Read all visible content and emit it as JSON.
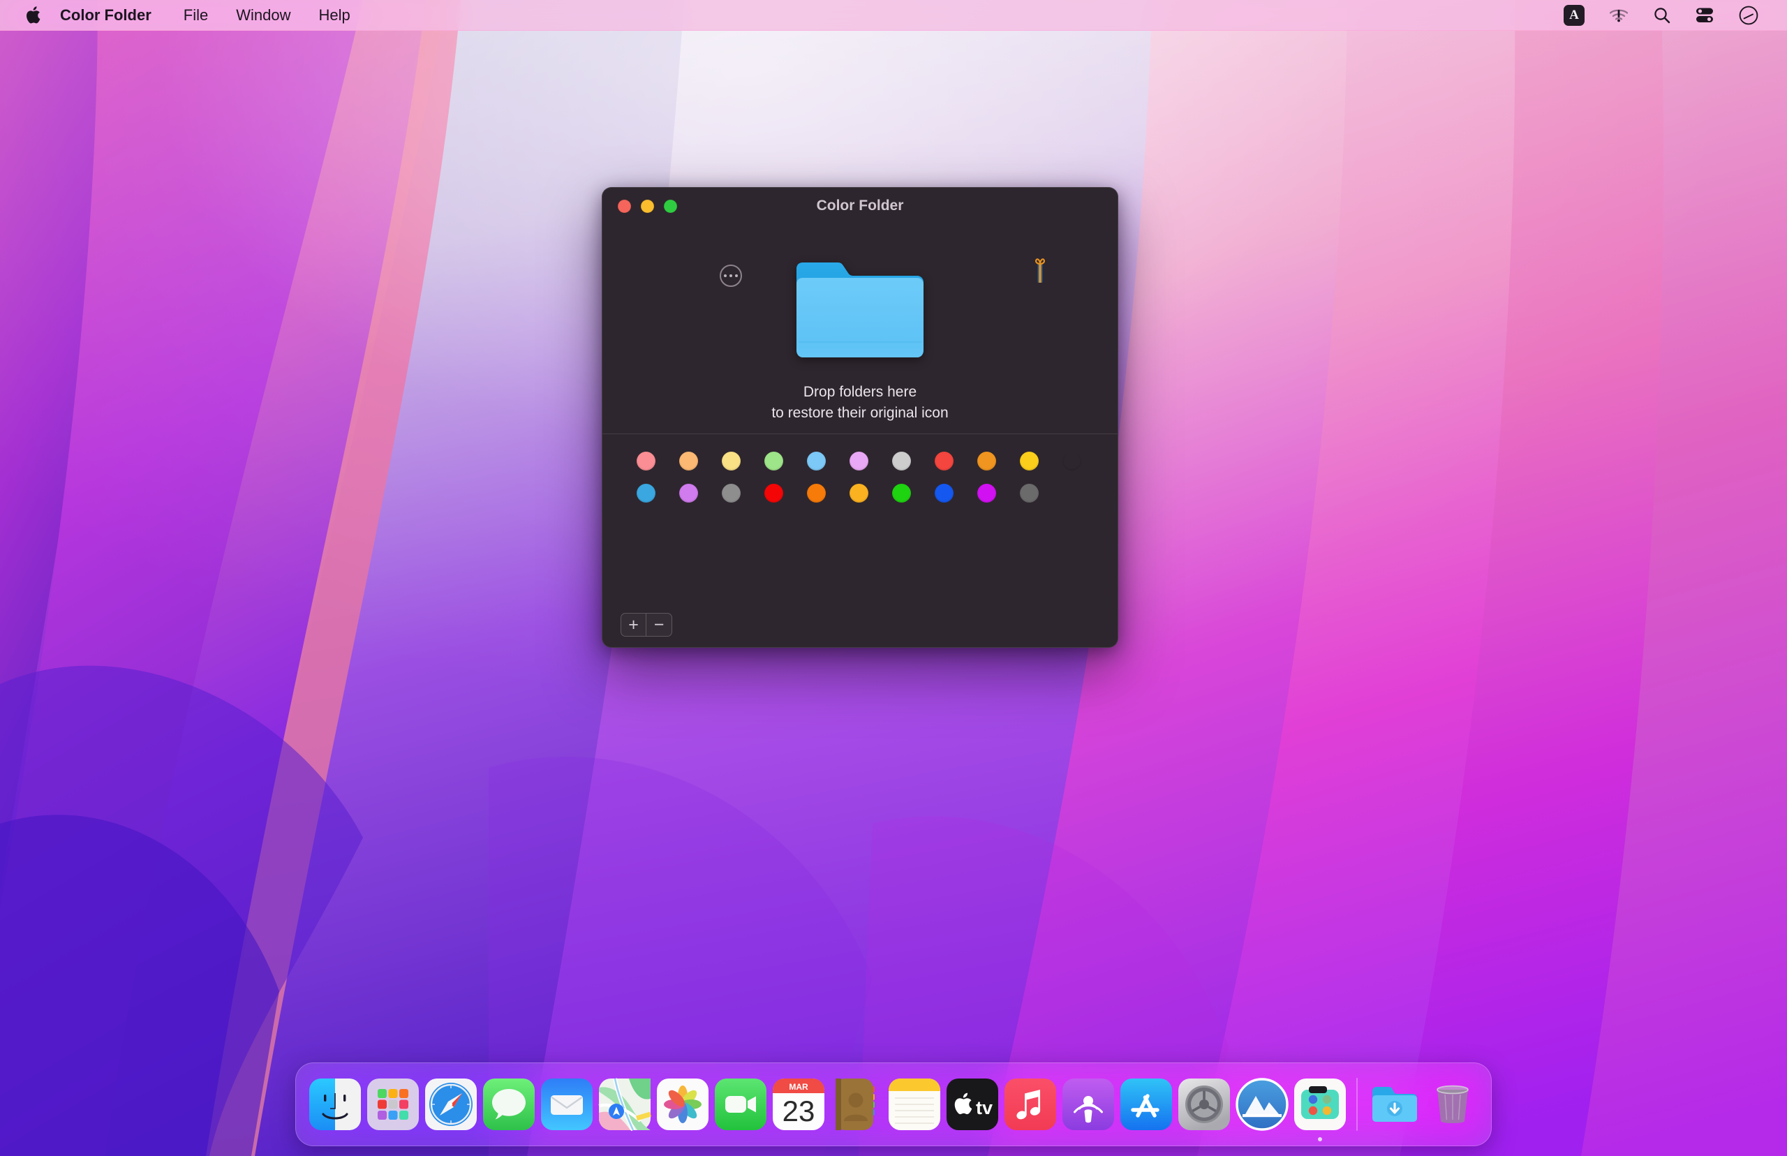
{
  "menubar": {
    "apple_icon": "apple-logo-icon",
    "app_name": "Color Folder",
    "items": [
      {
        "label": "File"
      },
      {
        "label": "Window"
      },
      {
        "label": "Help"
      }
    ],
    "status": [
      {
        "name": "input-source-icon",
        "label": "A"
      },
      {
        "name": "wifi-alert-icon",
        "label": ""
      },
      {
        "name": "spotlight-search-icon",
        "label": ""
      },
      {
        "name": "control-center-icon",
        "label": ""
      },
      {
        "name": "siri-icon",
        "label": ""
      }
    ]
  },
  "window": {
    "title": "Color Folder",
    "traffic_lights": [
      {
        "name": "close-button",
        "color": "#f5655b"
      },
      {
        "name": "minimize-button",
        "color": "#f9bd2e"
      },
      {
        "name": "maximize-button",
        "color": "#2fcc41"
      }
    ],
    "more_button_label": "…",
    "gift_button_label": "",
    "folder_colors": {
      "back": "#1e9fe0",
      "front": "#61c6f6",
      "edge": "#55bdf0"
    },
    "drop_text_line1": "Drop folders here",
    "drop_text_line2": "to restore their original icon",
    "footer": {
      "add_label": "+",
      "remove_label": "−"
    },
    "palette": {
      "rows": [
        [
          {
            "name": "swatch-pastel-pink",
            "color": "#fa8e94"
          },
          {
            "name": "swatch-pastel-orange",
            "color": "#fcb973"
          },
          {
            "name": "swatch-pastel-yellow",
            "color": "#fae185"
          },
          {
            "name": "swatch-pastel-green",
            "color": "#9ee489"
          },
          {
            "name": "swatch-pastel-blue",
            "color": "#7cc8f7"
          },
          {
            "name": "swatch-pastel-purple",
            "color": "#e9a8f5"
          },
          {
            "name": "swatch-light-gray",
            "color": "#cdcdcd"
          },
          {
            "name": "swatch-red",
            "color": "#f4453e"
          },
          {
            "name": "swatch-orange",
            "color": "#f0951f"
          },
          {
            "name": "swatch-yellow",
            "color": "#fbce1b"
          },
          {
            "name": "swatch-green",
            "color": "#76d martyrs"
          }
        ],
        [
          {
            "name": "swatch-blue",
            "color": "#3aa7e0"
          },
          {
            "name": "swatch-orchid",
            "color": "#d07bee"
          },
          {
            "name": "swatch-gray",
            "color": "#8e8e8e"
          },
          {
            "name": "swatch-pure-red",
            "color": "#f50606"
          },
          {
            "name": "swatch-deep-orange",
            "color": "#f77b09"
          },
          {
            "name": "swatch-amber",
            "color": "#fbb220"
          },
          {
            "name": "swatch-bright-green",
            "color": "#1ed310"
          },
          {
            "name": "swatch-bright-blue",
            "color": "#1458f0"
          },
          {
            "name": "swatch-magenta",
            "color": "#d111f2"
          },
          {
            "name": "swatch-dark-gray",
            "color": "#6b6b6b"
          }
        ]
      ]
    }
  },
  "dock": {
    "items": [
      {
        "name": "dock-item-finder",
        "label": "Finder",
        "running": false
      },
      {
        "name": "dock-item-launchpad",
        "label": "Launchpad",
        "running": false
      },
      {
        "name": "dock-item-safari",
        "label": "Safari",
        "running": false
      },
      {
        "name": "dock-item-messages",
        "label": "Messages",
        "running": false
      },
      {
        "name": "dock-item-mail",
        "label": "Mail",
        "running": false
      },
      {
        "name": "dock-item-maps",
        "label": "Maps",
        "running": false
      },
      {
        "name": "dock-item-photos",
        "label": "Photos",
        "running": false
      },
      {
        "name": "dock-item-facetime",
        "label": "FaceTime",
        "running": false
      },
      {
        "name": "dock-item-calendar",
        "label": "Calendar",
        "running": false,
        "month": "MAR",
        "day": "23"
      },
      {
        "name": "dock-item-contacts",
        "label": "Contacts",
        "running": false
      },
      {
        "name": "dock-item-notes",
        "label": "Notes",
        "running": false
      },
      {
        "name": "dock-item-appletv",
        "label": "Apple TV",
        "running": false
      },
      {
        "name": "dock-item-music",
        "label": "Music",
        "running": false
      },
      {
        "name": "dock-item-podcasts",
        "label": "Podcasts",
        "running": false
      },
      {
        "name": "dock-item-appstore",
        "label": "App Store",
        "running": false
      },
      {
        "name": "dock-item-system-preferences",
        "label": "System Preferences",
        "running": false
      },
      {
        "name": "dock-item-mountains-app",
        "label": "Mountains",
        "running": false
      },
      {
        "name": "dock-item-color-folder",
        "label": "Color Folder",
        "running": true
      }
    ],
    "right_items": [
      {
        "name": "dock-item-downloads-folder",
        "label": "Downloads"
      },
      {
        "name": "dock-item-trash",
        "label": "Trash"
      }
    ]
  }
}
